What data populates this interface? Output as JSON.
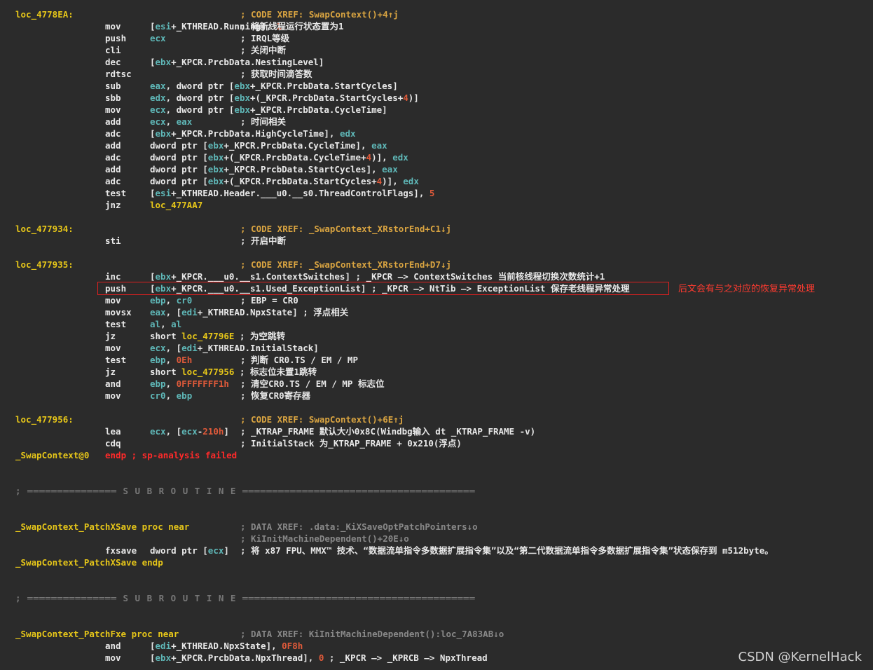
{
  "lines": [
    {
      "label": "loc_4778EA:",
      "mn": "",
      "op": "",
      "cmt": "; CODE XREF: SwapContext()+4↑j",
      "cmt_xref": true
    },
    {
      "label": "",
      "mn": "mov",
      "op": "[esi+_KTHREAD.Running], 1",
      "cmt": "; 将新线程运行状态置为1"
    },
    {
      "label": "",
      "mn": "push",
      "op": "ecx",
      "cmt": "; IRQL等级"
    },
    {
      "label": "",
      "mn": "cli",
      "op": "",
      "cmt": "; 关闭中断"
    },
    {
      "label": "",
      "mn": "dec",
      "op": "[ebx+_KPCR.PrcbData.NestingLevel]",
      "cmt": ""
    },
    {
      "label": "",
      "mn": "rdtsc",
      "op": "",
      "cmt": "; 获取时间滴答数"
    },
    {
      "label": "",
      "mn": "sub",
      "op": "eax, dword ptr [ebx+_KPCR.PrcbData.StartCycles]",
      "cmt": ""
    },
    {
      "label": "",
      "mn": "sbb",
      "op": "edx, dword ptr [ebx+(_KPCR.PrcbData.StartCycles+4)]",
      "cmt": ""
    },
    {
      "label": "",
      "mn": "mov",
      "op": "ecx, dword ptr [ebx+_KPCR.PrcbData.CycleTime]",
      "cmt": ""
    },
    {
      "label": "",
      "mn": "add",
      "op": "ecx, eax",
      "cmt": "; 时间相关"
    },
    {
      "label": "",
      "mn": "adc",
      "op": "[ebx+_KPCR.PrcbData.HighCycleTime], edx",
      "cmt": ""
    },
    {
      "label": "",
      "mn": "add",
      "op": "dword ptr [ebx+_KPCR.PrcbData.CycleTime], eax",
      "cmt": ""
    },
    {
      "label": "",
      "mn": "adc",
      "op": "dword ptr [ebx+(_KPCR.PrcbData.CycleTime+4)], edx",
      "cmt": ""
    },
    {
      "label": "",
      "mn": "add",
      "op": "dword ptr [ebx+_KPCR.PrcbData.StartCycles], eax",
      "cmt": ""
    },
    {
      "label": "",
      "mn": "adc",
      "op": "dword ptr [ebx+(_KPCR.PrcbData.StartCycles+4)], edx",
      "cmt": ""
    },
    {
      "label": "",
      "mn": "test",
      "op": "[esi+_KTHREAD.Header.___u0.__s0.ThreadControlFlags], 5",
      "cmt": ""
    },
    {
      "label": "",
      "mn": "jnz",
      "op": "loc_477AA7",
      "cmt": "",
      "op_label": true
    },
    {
      "label": "",
      "mn": "",
      "op": "",
      "cmt": ""
    },
    {
      "label": "loc_477934:",
      "mn": "",
      "op": "",
      "cmt": "; CODE XREF: _SwapContext_XRstorEnd+C1↓j",
      "cmt_xref": true
    },
    {
      "label": "",
      "mn": "sti",
      "op": "",
      "cmt": "; 开启中断"
    },
    {
      "label": "",
      "mn": "",
      "op": "",
      "cmt": ""
    },
    {
      "label": "loc_477935:",
      "mn": "",
      "op": "",
      "cmt": "; CODE XREF: _SwapContext_XRstorEnd+D7↓j",
      "cmt_xref": true
    },
    {
      "label": "",
      "mn": "inc",
      "op": "[ebx+_KPCR.___u0.__s1.ContextSwitches] ; _KPCR —> ContextSwitches 当前核线程切换次数统计+1",
      "cmt": ""
    },
    {
      "label": "",
      "mn": "push",
      "op": "[ebx+_KPCR.___u0.__s1.Used_ExceptionList] ; _KPCR —> NtTib —> ExceptionList 保存老线程异常处理",
      "cmt": ""
    },
    {
      "label": "",
      "mn": "mov",
      "op": "ebp, cr0",
      "cmt": "; EBP = CR0"
    },
    {
      "label": "",
      "mn": "movsx",
      "op": "eax, [edi+_KTHREAD.NpxState] ; 浮点相关",
      "cmt": ""
    },
    {
      "label": "",
      "mn": "test",
      "op": "al, al",
      "cmt": ""
    },
    {
      "label": "",
      "mn": "jz",
      "op": "short loc_47796E ; 为空跳转",
      "cmt": ""
    },
    {
      "label": "",
      "mn": "mov",
      "op": "ecx, [edi+_KTHREAD.InitialStack]",
      "cmt": ""
    },
    {
      "label": "",
      "mn": "test",
      "op": "ebp, 0Eh",
      "cmt": "; 判断 CR0.TS / EM / MP"
    },
    {
      "label": "",
      "mn": "jz",
      "op": "short loc_477956 ; 标志位未置1跳转",
      "cmt": ""
    },
    {
      "label": "",
      "mn": "and",
      "op": "ebp, 0FFFFFFF1h",
      "cmt": "; 清空CR0.TS / EM / MP 标志位"
    },
    {
      "label": "",
      "mn": "mov",
      "op": "cr0, ebp",
      "cmt": "; 恢复CR0寄存器"
    },
    {
      "label": "",
      "mn": "",
      "op": "",
      "cmt": ""
    },
    {
      "label": "loc_477956:",
      "mn": "",
      "op": "",
      "cmt": "; CODE XREF: SwapContext()+6E↑j",
      "cmt_xref": true
    },
    {
      "label": "",
      "mn": "lea",
      "op": "ecx, [ecx-210h]",
      "cmt": "; _KTRAP_FRAME 默认大小0x8C(Windbg输入 dt _KTRAP_FRAME -v)"
    },
    {
      "label": "",
      "mn": "cdq",
      "op": "",
      "cmt": "; InitialStack 为_KTRAP_FRAME + 0x210(浮点)"
    },
    {
      "label": "_SwapContext@0",
      "mn": "endp ; sp-analysis failed",
      "op": "",
      "cmt": "",
      "mn_red": true
    },
    {
      "label": "",
      "mn": "",
      "op": "",
      "cmt": ""
    },
    {
      "label": "",
      "mn": "",
      "op": "",
      "cmt": ""
    },
    {
      "sep": "; ═══════════════ S U B R O U T I N E ═══════════════════════════════════════"
    },
    {
      "label": "",
      "mn": "",
      "op": "",
      "cmt": ""
    },
    {
      "label": "",
      "mn": "",
      "op": "",
      "cmt": ""
    },
    {
      "label": "_SwapContext_PatchXSave proc near",
      "mn": "",
      "op": "",
      "cmt": "; DATA XREF: .data:_KiXSaveOptPatchPointers↓o",
      "cmt_dim": true
    },
    {
      "label": "",
      "mn": "",
      "op": "",
      "cmt": "; KiInitMachineDependent()+20E↓o",
      "cmt_dim": true
    },
    {
      "label": "",
      "mn": "fxsave",
      "op": "dword ptr [ecx]",
      "cmt": "; 将 x87 FPU、MMX™ 技术、“数据流单指令多数据扩展指令集”以及“第二代数据流单指令多数据扩展指令集”状态保存到 m512byte。"
    },
    {
      "label": "_SwapContext_PatchXSave endp",
      "mn": "",
      "op": "",
      "cmt": ""
    },
    {
      "label": "",
      "mn": "",
      "op": "",
      "cmt": ""
    },
    {
      "label": "",
      "mn": "",
      "op": "",
      "cmt": ""
    },
    {
      "sep": "; ═══════════════ S U B R O U T I N E ═══════════════════════════════════════"
    },
    {
      "label": "",
      "mn": "",
      "op": "",
      "cmt": ""
    },
    {
      "label": "",
      "mn": "",
      "op": "",
      "cmt": ""
    },
    {
      "label": "_SwapContext_PatchFxe proc near",
      "mn": "",
      "op": "",
      "cmt": "; DATA XREF: KiInitMachineDependent():loc_7A83AB↓o",
      "cmt_dim": true
    },
    {
      "label": "",
      "mn": "and",
      "op": "[edi+_KTHREAD.NpxState], 0F8h",
      "cmt": ""
    },
    {
      "label": "",
      "mn": "mov",
      "op": "[ebx+_KPCR.PrcbData.NpxThread], 0 ; _KPCR —> _KPRCB —> NpxThread",
      "cmt": ""
    }
  ],
  "annotation": "后文会有与之对应的恢复异常处理",
  "watermark": "CSDN @KernelHack"
}
